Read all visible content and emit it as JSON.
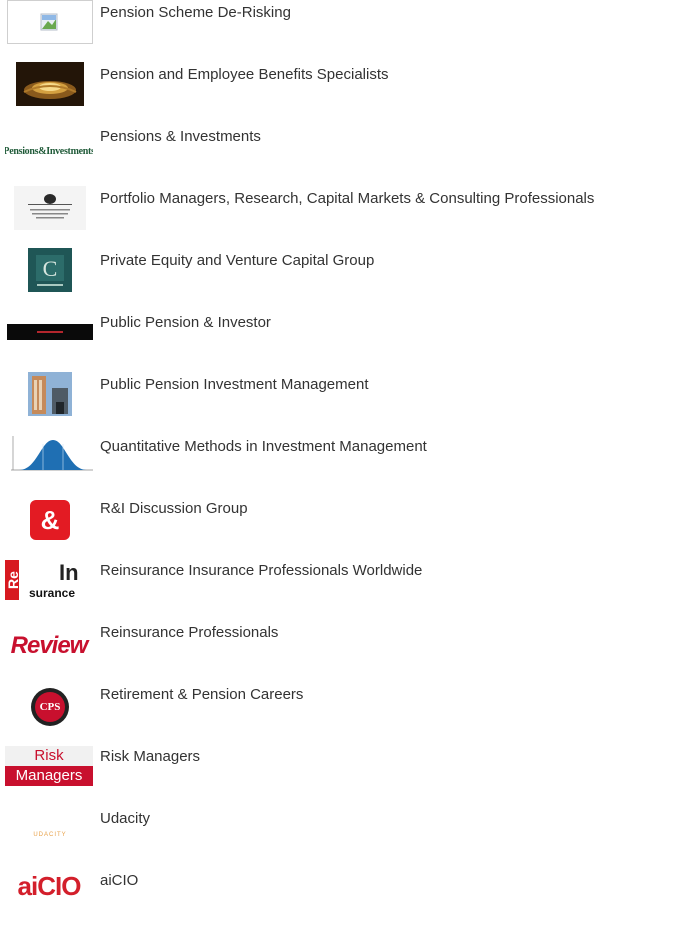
{
  "groups": [
    {
      "name": "Pension Scheme De-Risking",
      "icon": "broken-image-icon"
    },
    {
      "name": "Pension and Employee Benefits Specialists",
      "icon": "golden-nest-icon"
    },
    {
      "name": "Pensions & Investments",
      "icon": "pensions-investments-logo",
      "logo_text": "Pensions&Investments"
    },
    {
      "name": "Portfolio Managers, Research, Capital Markets & Consulting Professionals",
      "icon": "portfolio-managers-logo"
    },
    {
      "name": "Private Equity and Venture Capital Group",
      "icon": "private-equity-logo"
    },
    {
      "name": "Public Pension & Investor",
      "icon": "public-pension-banner"
    },
    {
      "name": "Public Pension Investment Management",
      "icon": "building-photo-icon"
    },
    {
      "name": "Quantitative Methods in Investment Management",
      "icon": "bell-curve-icon"
    },
    {
      "name": "R&I Discussion Group",
      "icon": "ampersand-icon"
    },
    {
      "name": "Reinsurance Insurance Professionals Worldwide",
      "icon": "reinsurance-logo",
      "logo_text_1": "Re",
      "logo_text_2": "In",
      "logo_text_3": "surance"
    },
    {
      "name": "Reinsurance Professionals",
      "icon": "review-logo",
      "logo_text": "Review"
    },
    {
      "name": "Retirement & Pension Careers",
      "icon": "cps-seal-icon",
      "logo_text": "CPS"
    },
    {
      "name": "Risk Managers",
      "icon": "risk-managers-logo",
      "logo_text_1": "Risk",
      "logo_text_2": "Managers"
    },
    {
      "name": "Udacity",
      "icon": "udacity-logo",
      "logo_text": "UDACITY"
    },
    {
      "name": "aiCIO",
      "icon": "aicio-logo",
      "logo_text": "aiCIO"
    }
  ],
  "colors": {
    "text": "#333333",
    "accent_red": "#e31b23",
    "ai_red": "#d31f2b"
  }
}
